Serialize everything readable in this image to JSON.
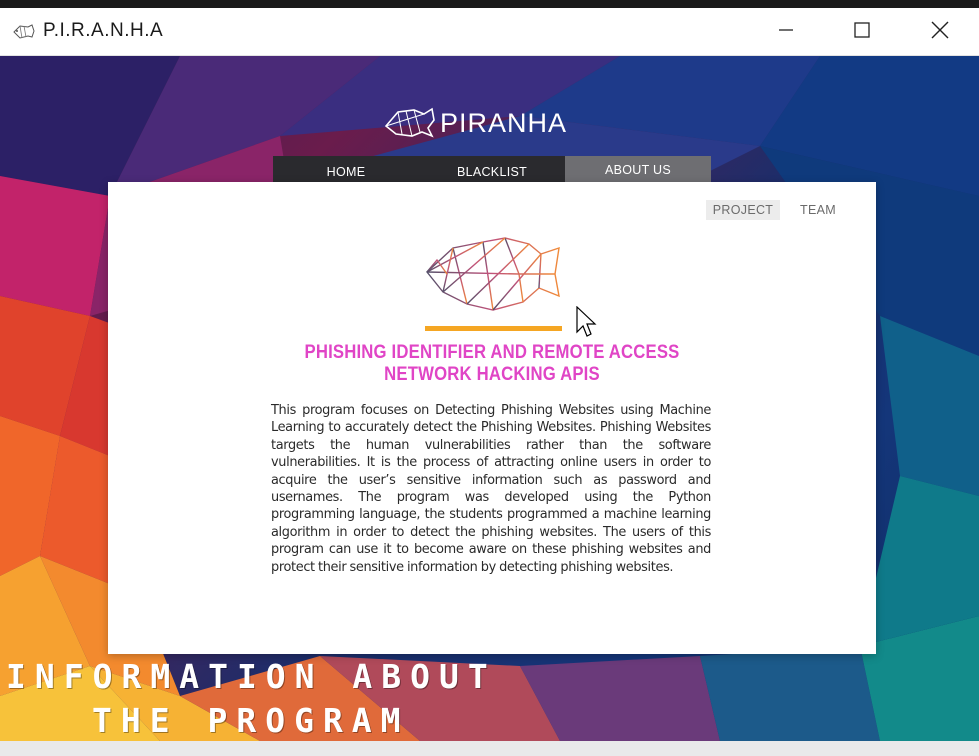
{
  "window": {
    "title": "P.I.R.A.N.H.A",
    "app_icon": "fish-icon",
    "controls": {
      "minimize_icon": "minimize-icon",
      "maximize_icon": "maximize-icon",
      "close_icon": "close-icon"
    }
  },
  "brand": {
    "name": "PIRANHA",
    "logo_icon": "piranha-logo-icon"
  },
  "nav": {
    "items": [
      {
        "label": "HOME"
      },
      {
        "label": "BLACKLIST"
      },
      {
        "label": "ABOUT US"
      }
    ],
    "active": "ABOUT US"
  },
  "about": {
    "subtabs": [
      {
        "label": "PROJECT"
      },
      {
        "label": "TEAM"
      }
    ],
    "active_subtab": "PROJECT",
    "logo_icon": "geometric-fish-icon",
    "heading": "PHISHING IDENTIFIER AND REMOTE ACCESS NETWORK HACKING APIS",
    "description": "This program focuses on Detecting Phishing Websites using Machine Learning to accurately detect the Phishing Websites. Phishing Websites targets the human vulnerabilities rather than the software vulnerabilities. It is the process of attracting online users in order to acquire the user’s sensitive information such as password and usernames. The program was developed using the Python programming language, the students programmed a machine learning algorithm in order to detect the phishing websites. The users of this program can use it to become aware on these phishing websites and protect their sensitive information by detecting phishing websites."
  },
  "caption": {
    "line1": "INFORMATION ABOUT",
    "line2": "THE PROGRAM"
  },
  "colors": {
    "heading": "#e045c6",
    "accent_line": "#f5a623",
    "nav_bg": "#2a2a2e",
    "nav_active_bg": "#6e6e72"
  },
  "cursor_icon": "mouse-pointer-icon"
}
